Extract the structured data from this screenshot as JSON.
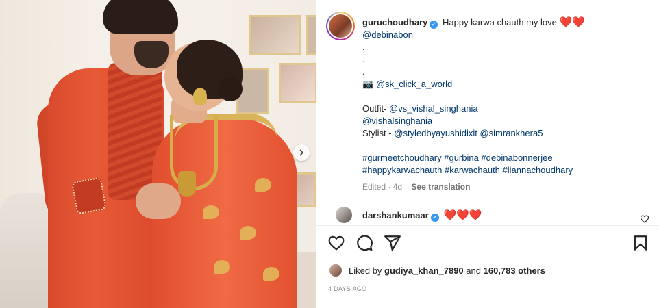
{
  "post": {
    "author": "guruchoudhary",
    "caption_text": "Happy karwa chauth my love",
    "caption_mention_1": "@debinabon",
    "dots": [
      ".",
      ".",
      "."
    ],
    "camera_emoji": "📷",
    "photographer": "@sk_click_a_world",
    "outfit_label": "Outfit-",
    "outfit_handle_1": "@vs_vishal_singhania",
    "outfit_handle_2": "@vishalsinghania",
    "stylist_label": "Stylist -",
    "stylist_handle_1": "@styledbyayushidixit",
    "stylist_handle_2": "@simrankhera5",
    "hashtags_line_1": "#gurmeetchoudhary #gurbina #debinabonnerjee",
    "hashtags_line_2": "#happykarwachauth #karwachauth #liannachoudhary",
    "edited_label": "Edited · 4d",
    "see_translation": "See translation"
  },
  "comment": {
    "username": "darshankumaar",
    "text": "❤️❤️❤️"
  },
  "likes": {
    "prefix": "Liked by",
    "user": "gudiya_khan_7890",
    "and": "and",
    "count": "160,783 others"
  },
  "timestamp": "4 DAYS AGO",
  "icons": {
    "like": "heart-icon",
    "comment": "comment-icon",
    "share": "paper-plane-icon",
    "save": "bookmark-icon",
    "verified": "verified-badge-icon",
    "carousel_next": "chevron-right-icon"
  },
  "colors": {
    "link": "#00376b",
    "verified": "#3897f0",
    "meta": "#8e8e8e",
    "heart": "#d90f2b"
  }
}
